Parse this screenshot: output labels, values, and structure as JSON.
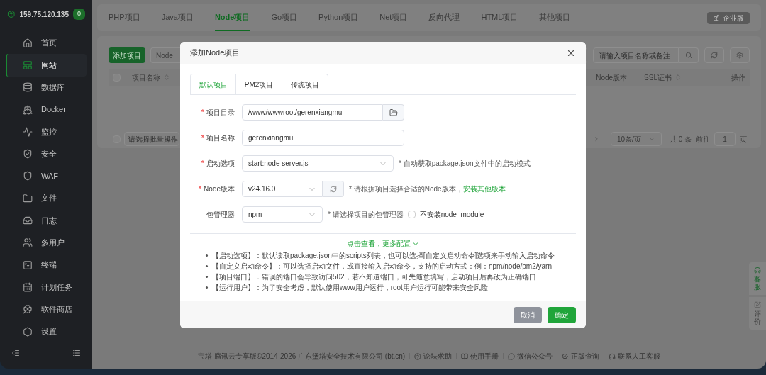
{
  "sidebar": {
    "host": "159.75.120.135",
    "badge": "0",
    "items": [
      {
        "label": "首页",
        "selected": false
      },
      {
        "label": "网站",
        "selected": true
      },
      {
        "label": "数据库",
        "selected": false
      },
      {
        "label": "Docker",
        "selected": false
      },
      {
        "label": "监控",
        "selected": false
      },
      {
        "label": "安全",
        "selected": false
      },
      {
        "label": "WAF",
        "selected": false
      },
      {
        "label": "文件",
        "selected": false
      },
      {
        "label": "日志",
        "selected": false
      },
      {
        "label": "多用户",
        "selected": false
      },
      {
        "label": "终端",
        "selected": false
      },
      {
        "label": "计划任务",
        "selected": false
      },
      {
        "label": "软件商店",
        "selected": false
      },
      {
        "label": "设置",
        "selected": false
      }
    ]
  },
  "top_tabs": [
    {
      "label": "PHP项目",
      "selected": false
    },
    {
      "label": "Java项目",
      "selected": false
    },
    {
      "label": "Node项目",
      "selected": true
    },
    {
      "label": "Go项目",
      "selected": false
    },
    {
      "label": "Python项目",
      "selected": false
    },
    {
      "label": "Net项目",
      "selected": false
    },
    {
      "label": "反向代理",
      "selected": false
    },
    {
      "label": "HTML项目",
      "selected": false
    },
    {
      "label": "其他项目",
      "selected": false
    }
  ],
  "edition_badge": "企业版",
  "toolbar": {
    "add_button": "添加项目",
    "filter_select": "Node",
    "search": {
      "placeholder": "请输入项目名称或备注"
    }
  },
  "table": {
    "select_all": {
      "checked": false
    },
    "columns": [
      {
        "label": "项目名称",
        "sortable": true
      },
      {
        "label": "Node版本",
        "sortable": false
      },
      {
        "label": "SSL证书",
        "sortable": true
      },
      {
        "label": "操作",
        "sortable": false
      }
    ]
  },
  "batch_select": {
    "checked": false,
    "placeholder": "请选择批量操作"
  },
  "pagination": {
    "page_size": "10条/页",
    "total": "共 0 条",
    "goto_label": "前往",
    "page": "1",
    "page_suffix": "页"
  },
  "dialog": {
    "title": "添加Node项目",
    "tabs": [
      {
        "label": "默认项目",
        "selected": true
      },
      {
        "label": "PM2项目",
        "selected": false
      },
      {
        "label": "传统项目",
        "selected": false
      }
    ],
    "fields": [
      {
        "kind": "path",
        "label": "项目目录",
        "mark": "*",
        "value": "/www/wwwroot/gerenxiangmu"
      },
      {
        "kind": "text",
        "label": "项目名称",
        "mark": "*",
        "value": "gerenxiangmu"
      },
      {
        "kind": "select",
        "label": "启动选项",
        "mark": "*",
        "value": "start:node server.js",
        "hint": "* 自动获取package.json文件中的启动模式"
      },
      {
        "kind": "version",
        "label": "Node版本",
        "mark": "*",
        "value": "v24.16.0",
        "hint": "* 请根据项目选择合适的Node版本，",
        "link": "安装其他版本"
      },
      {
        "kind": "manager",
        "label": "包管理器",
        "value": "npm",
        "hint": "* 请选择项目的包管理器",
        "checkbox": {
          "label": "不安装node_module",
          "checked": false
        }
      }
    ],
    "more_link": "点击查看，更多配置",
    "notes": [
      "【启动选项】：默认读取package.json中的scripts列表，也可以选择[自定义启动命令]选项来手动输入启动命令",
      "【自定义启动命令】：可以选择启动文件，或直接输入启动命令，支持的启动方式：例：npm/node/pm2/yarn",
      "【项目端口】：错误的端口会导致访问502，若不知道端口，可先随意填写，启动项目后再改为正确端口",
      "【运行用户】：为了安全考虑，默认使用www用户运行，root用户运行可能带来安全风险"
    ],
    "cancel": "取消",
    "confirm": "确定"
  },
  "footer": {
    "copyright": "宝塔-腾讯云专享版©2014-2026 广东堡塔安全技术有限公司 (bt.cn)",
    "links": [
      "论坛求助",
      "使用手册",
      "微信公众号",
      "正版查询",
      "联系人工客服"
    ]
  },
  "side_widget": [
    "客服",
    "评价"
  ]
}
